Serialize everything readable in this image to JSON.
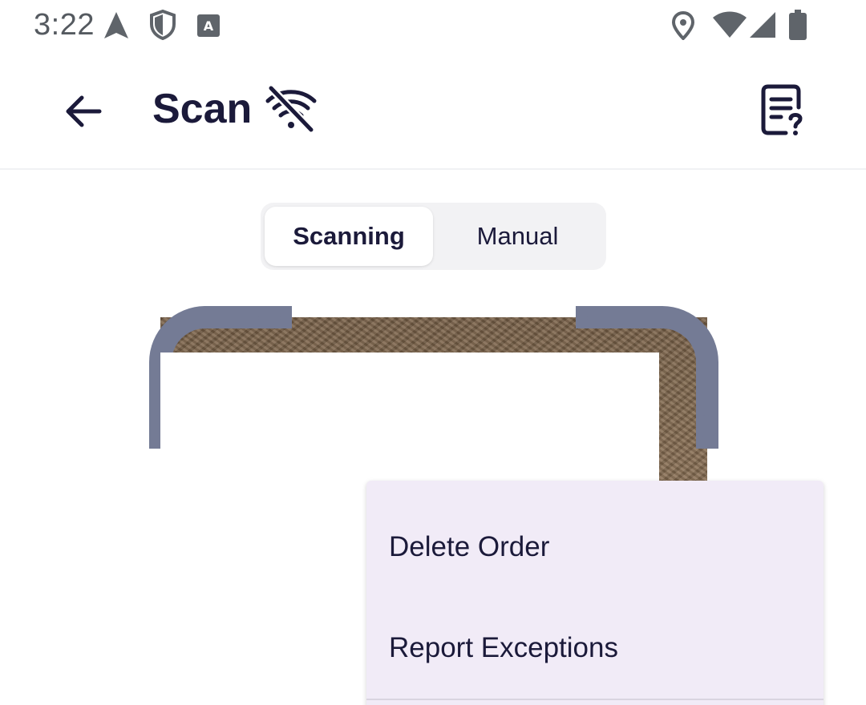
{
  "status_bar": {
    "time": "3:22",
    "icons": [
      "navigation-icon",
      "shield-icon",
      "keyboard-a-icon",
      "location-icon",
      "wifi-icon",
      "signal-icon",
      "battery-icon"
    ]
  },
  "app_bar": {
    "title": "Scan",
    "back_icon": "arrow-left-icon",
    "offline_icon": "wifi-off-icon",
    "help_icon": "document-question-icon"
  },
  "mode_toggle": {
    "options": [
      {
        "label": "Scanning",
        "selected": true
      },
      {
        "label": "Manual",
        "selected": false
      }
    ]
  },
  "menu": {
    "items": [
      {
        "label": "Delete Order"
      },
      {
        "label": "Report Exceptions"
      }
    ]
  },
  "colors": {
    "primary_text": "#1b1a3a",
    "viewfinder_frame": "#747b95",
    "menu_background": "#f1ebf7",
    "status_text": "#555a60"
  }
}
